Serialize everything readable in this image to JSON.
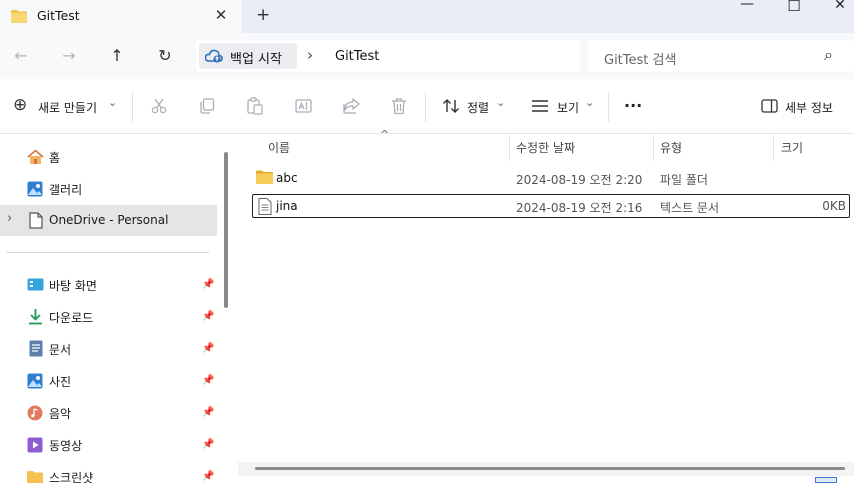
{
  "window": {
    "tab_title": "GitTest",
    "tab_close": "✕",
    "new_tab": "+",
    "minimize": "—",
    "maximize": "☐",
    "close": "✕"
  },
  "address": {
    "back": "←",
    "forward": "→",
    "up": "↑",
    "refresh": "↻",
    "crumbs": [
      "백업 시작",
      "GitTest"
    ],
    "crumb_sep": "›",
    "search_placeholder": "GitTest 검색",
    "search_icon": "⌕"
  },
  "toolbar": {
    "new_label": "새로 만들기",
    "new_icon": "⊕",
    "sort_label": "정렬",
    "view_label": "보기",
    "more_label": "···",
    "details_label": "세부 정보",
    "chevron": "⌄"
  },
  "sidebar": {
    "top_items": [
      {
        "label": "홈",
        "icon": "home-icon"
      },
      {
        "label": "갤러리",
        "icon": "gallery-icon"
      },
      {
        "label": "OneDrive - Personal",
        "icon": "onedrive-icon"
      }
    ],
    "expand_glyph": "›",
    "pinned_items": [
      {
        "label": "바탕 화면",
        "icon": "desktop-icon"
      },
      {
        "label": "다운로드",
        "icon": "download-icon"
      },
      {
        "label": "문서",
        "icon": "documents-icon"
      },
      {
        "label": "사진",
        "icon": "pictures-icon"
      },
      {
        "label": "음악",
        "icon": "music-icon"
      },
      {
        "label": "동영상",
        "icon": "videos-icon"
      },
      {
        "label": "스크린샷",
        "icon": "screenshots-icon"
      }
    ]
  },
  "table": {
    "sort_glyph": "^",
    "columns": [
      "이름",
      "수정한 날짜",
      "유형",
      "크기"
    ],
    "rows": [
      {
        "name": "abc",
        "modified": "2024-08-19 오전 2:20",
        "type": "파일 폴더",
        "size": "",
        "icon": "folder-icon"
      },
      {
        "name": "jina",
        "modified": "2024-08-19 오전 2:16",
        "type": "텍스트 문서",
        "size": "0KB",
        "icon": "text-file-icon"
      }
    ]
  },
  "colors": {
    "accent": "#0067c0",
    "folder": "#f4c34d"
  }
}
